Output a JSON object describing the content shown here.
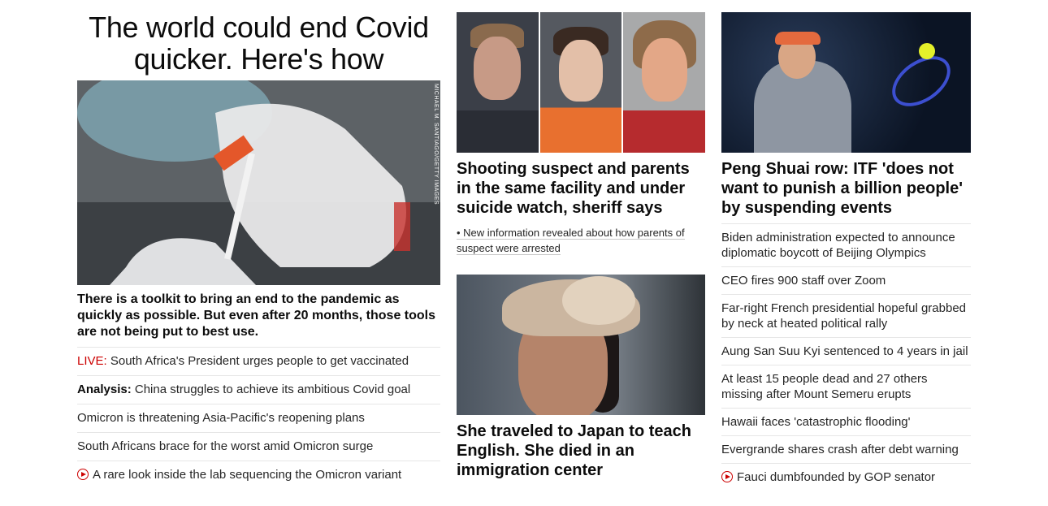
{
  "left": {
    "headline": "The world could end Covid quicker. Here's how",
    "image_credit": "MICHAEL M. SANTIAGO/GETTY IMAGES",
    "description": "There is a toolkit to bring an end to the pandemic as quickly as possible. But even after 20 months, those tools are not being put to best use.",
    "links": [
      {
        "prefix": "LIVE:",
        "text": " South Africa's President urges people to get vaccinated"
      },
      {
        "prefix": "Analysis:",
        "text": " China struggles to achieve its ambitious Covid goal"
      },
      {
        "text": "Omicron is threatening Asia-Pacific's reopening plans"
      },
      {
        "text": "South Africans brace for the worst amid Omicron surge"
      },
      {
        "icon": "play-icon",
        "text": "A rare look inside the lab sequencing the Omicron variant"
      }
    ]
  },
  "middle": {
    "story1": {
      "headline": "Shooting suspect and parents in the same facility and under suicide watch, sheriff says",
      "sublink": "• New information revealed about how parents of suspect were arrested"
    },
    "story2": {
      "headline": "She traveled to Japan to teach English. She died in an immigration center"
    }
  },
  "right": {
    "headline": "Peng Shuai row: ITF 'does not want to punish a billion people' by suspending events",
    "links": [
      {
        "text": "Biden administration expected to announce diplomatic boycott of Beijing Olympics"
      },
      {
        "text": "CEO fires 900 staff over Zoom"
      },
      {
        "text": "Far-right French presidential hopeful grabbed by neck at heated political rally"
      },
      {
        "text": "Aung San Suu Kyi sentenced to 4 years in jail"
      },
      {
        "text": "At least 15 people dead and 27 others missing after Mount Semeru erupts"
      },
      {
        "text": "Hawaii faces 'catastrophic flooding'"
      },
      {
        "text": "Evergrande shares crash after debt warning"
      },
      {
        "icon": "play-icon",
        "text": "Fauci dumbfounded by GOP senator"
      }
    ]
  },
  "colors": {
    "live_red": "#cc0000",
    "text": "#262626",
    "divider": "#e6e6e6"
  }
}
